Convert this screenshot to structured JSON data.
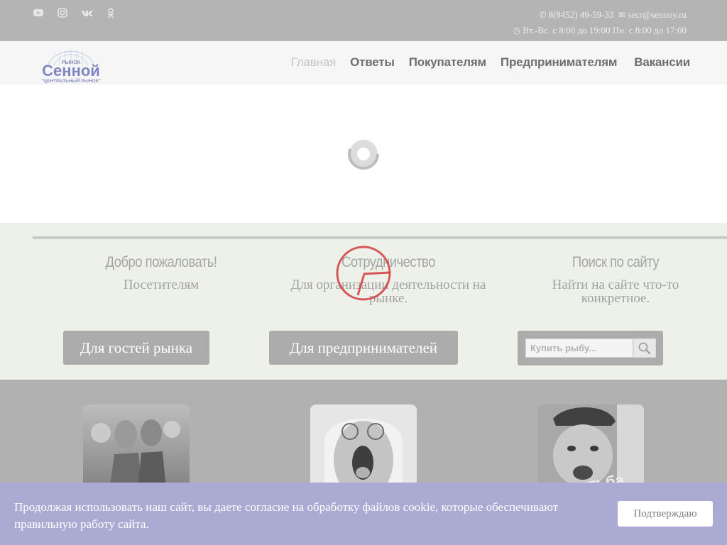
{
  "topbar": {
    "social": [
      "youtube-icon",
      "instagram-icon",
      "vk-icon",
      "odnoklassniki-icon"
    ],
    "phone": "8(8452) 49-59-33",
    "email": "secr@sennoy.ru",
    "hours": "Вт.-Вс. с 8:00 до 19:00 Пн. с 8:00 до 17:00"
  },
  "logo": {
    "top": "РЫНОК",
    "main": "Сенной",
    "bottom": "\"ЦЕНТРАЛЬНЫЙ РЫНОК\""
  },
  "nav": {
    "items": [
      {
        "label": "Главная",
        "active": true
      },
      {
        "label": "Ответы"
      },
      {
        "label": "Покупателям"
      },
      {
        "label": "Предпринимателям"
      },
      {
        "label": "Вакансии"
      }
    ]
  },
  "welcome": {
    "col1": {
      "title": "Добро пожаловать!",
      "text": "Посетителям"
    },
    "col2": {
      "title": "Сотрудничество",
      "text": "Для организации деятельности на рынке."
    },
    "col3": {
      "title": "Поиск по сайту",
      "text": "Найти на сайте что-то конкретное."
    },
    "guest_button": "Для гостей рынка",
    "business_button": "Для предпринимателей",
    "search_placeholder": "Купить рыбу..."
  },
  "cookie": {
    "text": "Продолжая использовать наш сайт, вы даете согласие на обработку файлов cookie, которые обеспечивают правильную работу сайта.",
    "button": "Подтверждаю"
  },
  "colors": {
    "topbar": "#b4b4b4",
    "cookie_bar": "#abaad3",
    "button": "#acacac",
    "stamp": "#d23c3c"
  }
}
